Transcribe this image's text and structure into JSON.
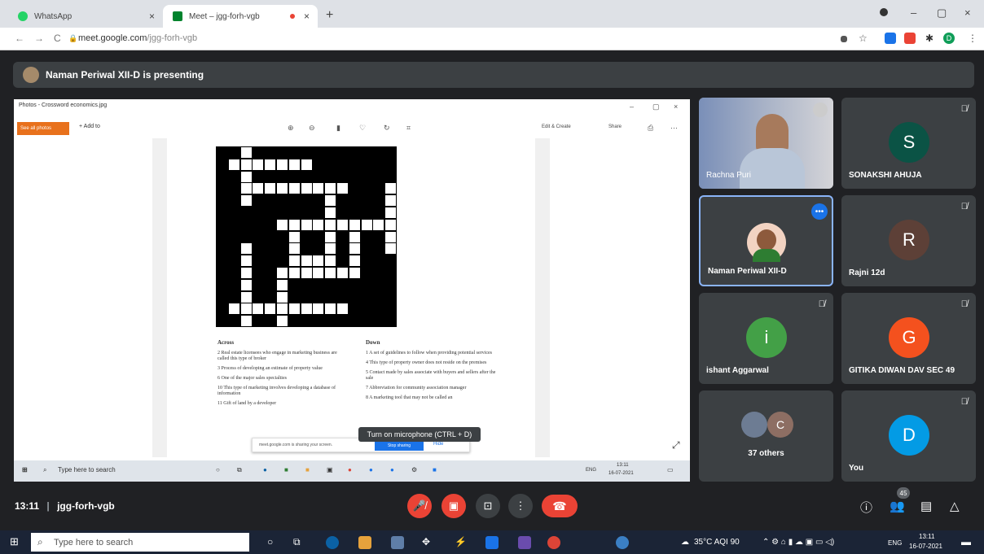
{
  "browser": {
    "tabs": [
      {
        "label": "WhatsApp",
        "close": "×",
        "favicon_color": "#25d366"
      },
      {
        "label": "Meet – jgg-forh-vgb",
        "close": "×",
        "favicon_color": "#00832d"
      }
    ],
    "new_tab": "+",
    "window_controls": {
      "minimize": "–",
      "maximize": "▢",
      "close": "×"
    },
    "nav": {
      "back": "←",
      "forward": "→",
      "reload": "C"
    },
    "url_host": "meet.google.com",
    "url_path": "/jgg-forh-vgb",
    "profile_initial": "D"
  },
  "meet": {
    "presenting_text": "Naman Periwal XII-D is presenting",
    "meeting_time": "13:11",
    "meeting_separator": "|",
    "meeting_code": "jgg-forh-vgb",
    "tooltip": "Turn on microphone (CTRL + D)",
    "participant_count": "45",
    "participants": [
      {
        "name": "Rachna Puri",
        "type": "video"
      },
      {
        "name": "SONAKSHI AHUJA",
        "initial": "S",
        "color": "#0b5345"
      },
      {
        "name": "Naman Periwal XII-D",
        "type": "video",
        "highlighted": true
      },
      {
        "name": "Rajni 12d",
        "initial": "R",
        "color": "#5d4037"
      },
      {
        "name": "ishant Aggarwal",
        "initial": "i",
        "color": "#43a047"
      },
      {
        "name": "GITIKA DIWAN DAV SEC 49",
        "initial": "G",
        "color": "#f4511e"
      },
      {
        "name": "37 others",
        "initial": "C",
        "color": "#8d6e63"
      },
      {
        "name": "You",
        "initial": "D",
        "color": "#039be5"
      }
    ],
    "controls": {
      "mic": "mic-off-icon",
      "camera": "camera-off-icon",
      "present": "present-icon",
      "more": "more-icon",
      "end": "end-call-icon"
    }
  },
  "shared_screen": {
    "window_title": "Photos - Crossword economics.jpg",
    "see_all": "See all photos",
    "add_to": "+ Add to",
    "edit_create": "Edit & Create",
    "share": "Share",
    "across_heading": "Across",
    "across_clues": [
      "2  Real estate licensees who engage in marketing business are called this type of broker",
      "3  Process of developing an estimate of property value",
      "6  One of the major sales specialties",
      "10  This type of marketing involves developing a database of information",
      "11  Gift of land by a developer"
    ],
    "down_heading": "Down",
    "down_clues": [
      "1  A set of guidelines to follow when providing potential services",
      "4  This type of property owner does not reside on the premises",
      "5  Contact made by sales associate with buyers and sellers after the sale",
      "7  Abbreviation for community association manager",
      "8  A marketing tool that may not be called an"
    ],
    "share_notice": "meet.google.com is sharing your screen.",
    "stop_sharing": "Stop sharing",
    "hide": "Hide",
    "inner_search": "Type here to search",
    "inner_clock_time": "13:11",
    "inner_clock_date": "16-07-2021",
    "inner_lang": "ENG"
  },
  "taskbar": {
    "search_placeholder": "Type here to search",
    "weather": "35°C  AQI 90",
    "lang": "ENG",
    "clock_time": "13:11",
    "clock_date": "16-07-2021"
  }
}
